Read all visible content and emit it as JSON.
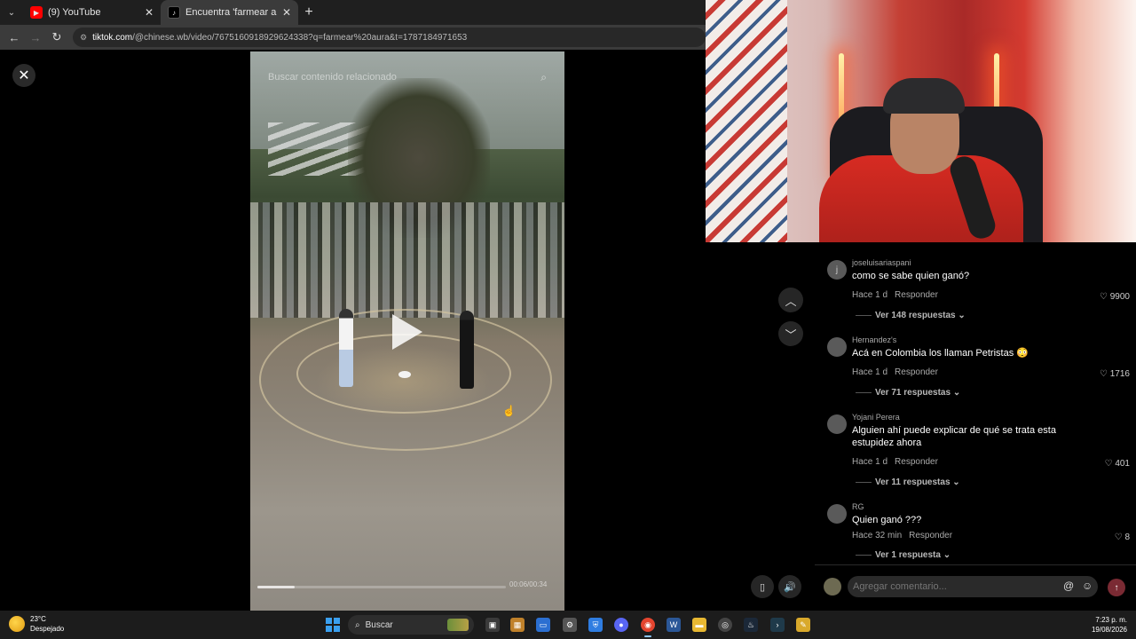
{
  "browser": {
    "tabs": [
      {
        "title": "(9) YouTube",
        "active": false,
        "favicon": "youtube-icon"
      },
      {
        "title": "Encuentra 'farmear aura' en TikTok",
        "active": true,
        "favicon": "tiktok-icon"
      }
    ],
    "url_host": "tiktok.com",
    "url_path": "/@chinese.wb/video/7675160918929624338?q=farmear%20aura&t=1787184971653"
  },
  "video": {
    "search_placeholder": "Buscar contenido relacionado",
    "progress": 0.15,
    "timecode": "00:06/00:34"
  },
  "comments": [
    {
      "initial": "j",
      "user": "joseluisariaspani",
      "text": "como se sabe quien ganó?",
      "time": "Hace 1 d",
      "reply_label": "Responder",
      "likes": "9900",
      "replies": "Ver 148 respuestas"
    },
    {
      "initial": "",
      "user": "Hernandez's",
      "text": "Acá en Colombia los llaman Petristas 😳",
      "time": "Hace 1 d",
      "reply_label": "Responder",
      "likes": "1716",
      "replies": "Ver 71 respuestas"
    },
    {
      "initial": "",
      "user": "Yojani Perera",
      "text": "Alguien ahí puede explicar de qué se trata esta estupidez ahora",
      "time": "Hace 1 d",
      "reply_label": "Responder",
      "likes": "401",
      "replies": "Ver 11 respuestas"
    },
    {
      "initial": "",
      "user": "RG",
      "text": "Quien ganó ???",
      "time": "Hace 32 min",
      "reply_label": "Responder",
      "likes": "8",
      "replies": "Ver 1 respuesta"
    }
  ],
  "comment_bar": {
    "placeholder": "Agregar comentario..."
  },
  "taskbar": {
    "weather_temp": "23°C",
    "weather_desc": "Despejado",
    "search_label": "Buscar",
    "time": "7:23 p. m.",
    "date": "19/08/2026"
  },
  "colors": {
    "accent": "#fe2c55",
    "youtube": "#ff0000",
    "windows": "#3aa0f0"
  }
}
